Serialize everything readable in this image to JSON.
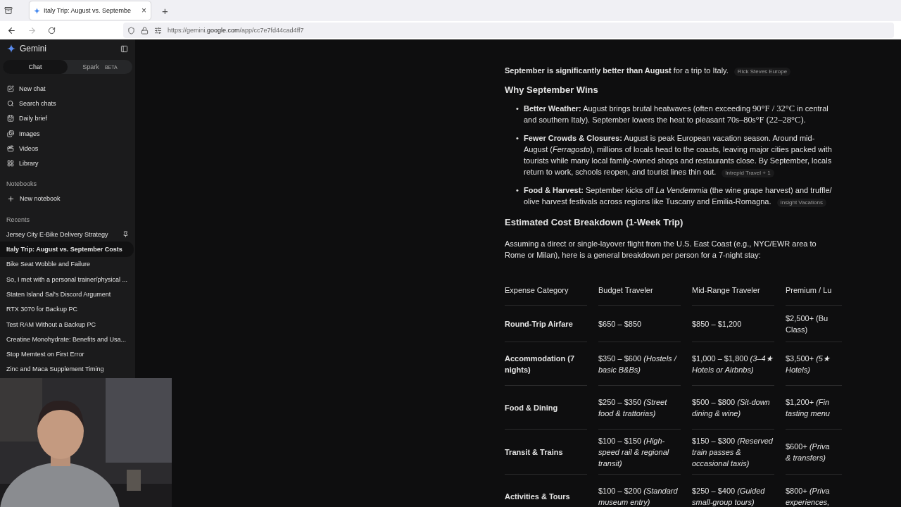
{
  "browser": {
    "tab": {
      "title": "Italy Trip: August vs. Septembe",
      "close": "×"
    },
    "new_tab": "+",
    "url": {
      "prefix": "https://gemini.",
      "domain": "google.com",
      "path": "/app/cc7e7fd44cad4ff7"
    }
  },
  "sidebar": {
    "brand": "Gemini",
    "modes": [
      {
        "label": "Chat",
        "selected": true
      },
      {
        "label": "Spark",
        "badge": "BETA",
        "selected": false
      }
    ],
    "nav": [
      {
        "label": "New chat"
      },
      {
        "label": "Search chats"
      },
      {
        "label": "Daily brief"
      },
      {
        "label": "Images"
      },
      {
        "label": "Videos"
      },
      {
        "label": "Library"
      }
    ],
    "notebooks": {
      "heading": "Notebooks",
      "new": "New notebook"
    },
    "recents": {
      "heading": "Recents",
      "items": [
        {
          "title": "Jersey City E-Bike Delivery Strategy",
          "pinned": true,
          "selected": false
        },
        {
          "title": "Italy Trip: August vs. September Costs",
          "pinned": false,
          "selected": true
        },
        {
          "title": "Bike Seat Wobble and Failure",
          "pinned": false,
          "selected": false
        },
        {
          "title": "So, I met with a personal trainer/physical ...",
          "pinned": false,
          "selected": false
        },
        {
          "title": "Staten Island Sal's Discord Argument",
          "pinned": false,
          "selected": false
        },
        {
          "title": "RTX 3070 for Backup PC",
          "pinned": false,
          "selected": false
        },
        {
          "title": "Test RAM Without a Backup PC",
          "pinned": false,
          "selected": false
        },
        {
          "title": "Creatine Monohydrate: Benefits and Usa...",
          "pinned": false,
          "selected": false
        },
        {
          "title": "Stop Memtest on First Error",
          "pinned": false,
          "selected": false
        },
        {
          "title": "Zinc and Maca Supplement Timing",
          "pinned": false,
          "selected": false
        }
      ]
    }
  },
  "response": {
    "intro": {
      "text": "**September is significantly better than August** for a trip to Italy.",
      "source": "Rick Steves Europe"
    },
    "section_1": "Why September Wins",
    "bullets": [
      {
        "marker": "•",
        "lead": "Better Weather:",
        "parts": [
          {
            "kind": "text",
            "text": " August brings brutal heatwaves (often exceeding "
          },
          {
            "kind": "math",
            "text": "90°F / 32°C"
          },
          {
            "kind": "text",
            "text": " in central and southern Italy). September lowers the heat to pleasant "
          },
          {
            "kind": "math",
            "text": "70s–80s°F (22–28°C)"
          },
          {
            "kind": "text",
            "text": "."
          }
        ]
      },
      {
        "marker": "•",
        "lead": "Fewer Crowds & Closures:",
        "parts": [
          {
            "kind": "text",
            "text": " August is peak European vacation season. Around mid-August ("
          },
          {
            "kind": "italic",
            "text": "Ferragosto"
          },
          {
            "kind": "text",
            "text": "), millions of locals head to the coasts, leaving major cities packed with tourists while many local family-owned shops and restaurants close. By September, locals return to work, schools reopen, and tourist lines thin out."
          }
        ],
        "source": "Intrepid Travel + 1"
      },
      {
        "marker": "•",
        "lead": "Food & Harvest:",
        "parts": [
          {
            "kind": "text",
            "text": " September kicks off "
          },
          {
            "kind": "italic",
            "text": "La Vendemmia"
          },
          {
            "kind": "text",
            "text": " (the wine grape harvest) and truffle/ olive harvest festivals across regions like Tuscany and Emilia-Romagna."
          }
        ],
        "source": "Insight Vacations"
      }
    ],
    "section_2": "Estimated Cost Breakdown (1-Week Trip)",
    "paragraph": "Assuming a direct or single-layover flight from the U.S. East Coast (e.g., NYC/EWR area to Rome or Milan), here is a general breakdown per person for a 7-night stay:",
    "table": {
      "columns": [
        "Expense Category",
        "Budget Traveler",
        "Mid-Range Traveler",
        "Premium / Lu"
      ],
      "rows": [
        [
          [
            "Round-Trip Airfare"
          ],
          [
            "$650 – $850"
          ],
          [
            "$850 – $1,200"
          ],
          [
            "$2,500+ (Bu",
            "Class)"
          ]
        ],
        [
          [
            "Accommodation (7",
            "nights)"
          ],
          [
            "$350 – $600 *(Hostels /*",
            "*basic B&Bs)*"
          ],
          [
            "$1,000 – $1,800 *(3–4★*",
            "*Hotels or Airbnbs)*"
          ],
          [
            "$3,500+ *(5★*",
            "*Hotels)*"
          ]
        ],
        [
          [
            "Food & Dining"
          ],
          [
            "$250 – $350 *(Street*",
            "*food & trattorias)*"
          ],
          [
            "$500 – $800 *(Sit-down*",
            "*dining & wine)*"
          ],
          [
            "$1,200+ *(Fin*",
            "*tasting menu*"
          ]
        ],
        [
          [
            "Transit & Trains"
          ],
          [
            "$100 – $150 *(High-*",
            "*speed rail & regional*",
            "*transit)*"
          ],
          [
            "$150 – $300 *(Reserved*",
            "*train passes &*",
            "*occasional taxis)*"
          ],
          [
            "$600+ *(Priva*",
            "*& transfers)*"
          ]
        ],
        [
          [
            "Activities & Tours"
          ],
          [
            "$100 – $200 *(Standard*",
            "*museum entry)*"
          ],
          [
            "$250 – $400 *(Guided*",
            "*small-group tours)*"
          ],
          [
            "$800+ *(Priva*",
            "*experiences,*"
          ]
        ]
      ]
    }
  }
}
